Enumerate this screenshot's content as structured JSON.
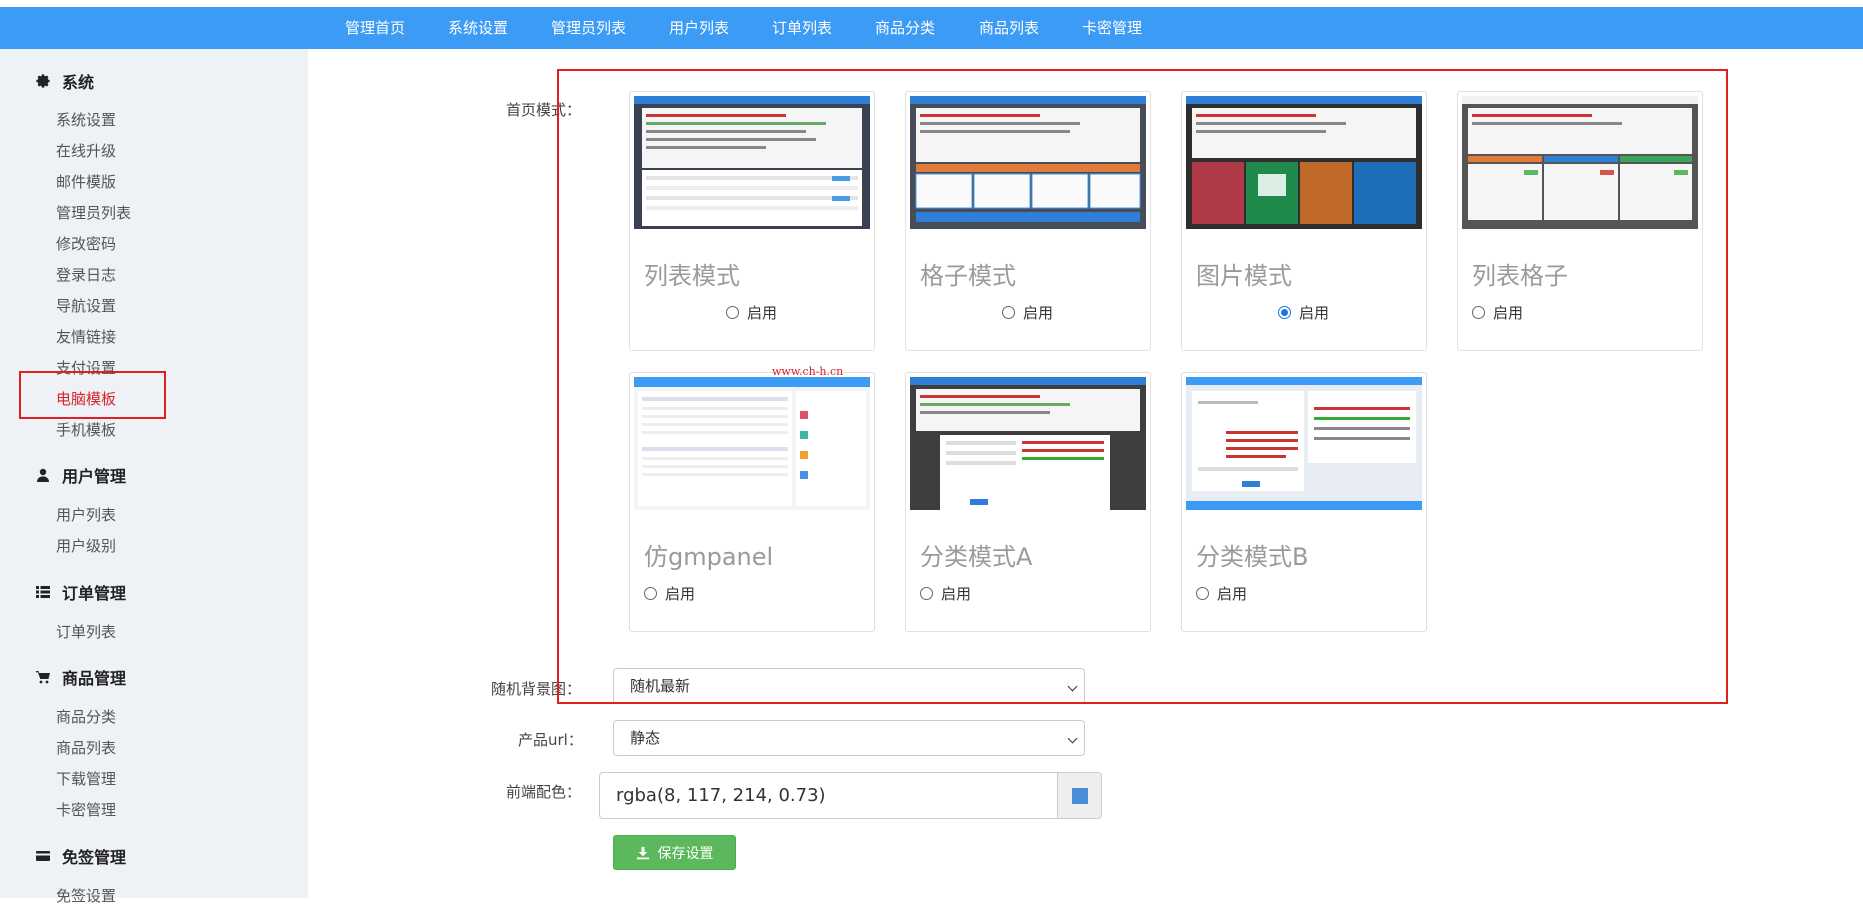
{
  "topnav": {
    "items": [
      "管理首页",
      "系统设置",
      "管理员列表",
      "用户列表",
      "订单列表",
      "商品分类",
      "商品列表",
      "卡密管理"
    ],
    "bg_color": "#3c9bf4"
  },
  "sidebar": {
    "sections": [
      {
        "title": "系统",
        "icon": "gear-icon",
        "items": [
          "系统设置",
          "在线升级",
          "邮件模版",
          "管理员列表",
          "修改密码",
          "登录日志",
          "导航设置",
          "友情链接",
          "支付设置",
          "电脑模板",
          "手机模板"
        ]
      },
      {
        "title": "用户管理",
        "icon": "user-icon",
        "items": [
          "用户列表",
          "用户级别"
        ]
      },
      {
        "title": "订单管理",
        "icon": "list-icon",
        "items": [
          "订单列表"
        ]
      },
      {
        "title": "商品管理",
        "icon": "cart-icon",
        "items": [
          "商品分类",
          "商品列表",
          "下载管理",
          "卡密管理"
        ]
      },
      {
        "title": "免签管理",
        "icon": "card-icon",
        "items": [
          "免签设置"
        ]
      }
    ],
    "active_item": "电脑模板"
  },
  "form": {
    "homepage_mode_label": "首页模式：",
    "random_bg_label": "随机背景图：",
    "product_url_label": "产品url：",
    "front_color_label": "前端配色：",
    "random_bg_value": "随机最新",
    "product_url_value": "静态",
    "front_color_value": "rgba(8, 117, 214, 0.73)",
    "save_label": "保存设置",
    "enable_label": "启用",
    "watermark": "www.ch-h.cn"
  },
  "templates": [
    {
      "name": "列表模式",
      "checked": false
    },
    {
      "name": "格子模式",
      "checked": false
    },
    {
      "name": "图片模式",
      "checked": true
    },
    {
      "name": "列表格子",
      "checked": false
    },
    {
      "name": "仿gmpanel",
      "checked": false
    },
    {
      "name": "分类模式A",
      "checked": false
    },
    {
      "name": "分类模式B",
      "checked": false
    }
  ],
  "colors": {
    "accent": "#3c9bf4",
    "highlight_border": "#e0201f",
    "save_button": "#5cb85c",
    "active_link": "#d9232a",
    "radio_checked": "#1a73e8"
  }
}
